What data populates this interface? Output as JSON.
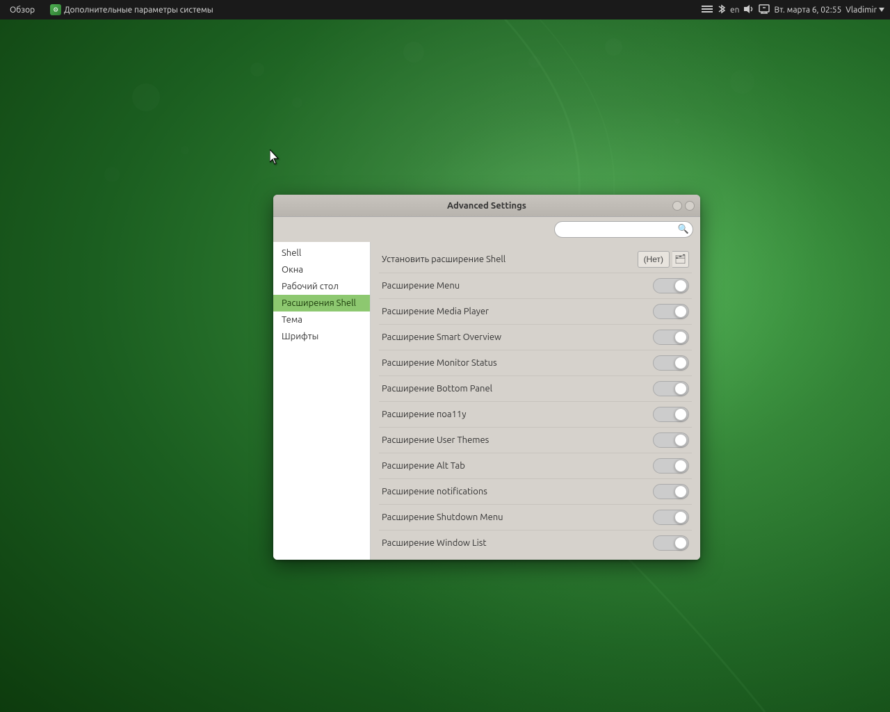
{
  "desktop": {
    "bg_color_start": "#4caf50",
    "bg_color_end": "#0d3b0d"
  },
  "topbar": {
    "overview_label": "Обзор",
    "app_title": "Дополнительные параметры системы",
    "indicators": {
      "network": "⊞",
      "bluetooth": "⬡",
      "lang": "en",
      "volume": "🔊",
      "screen": "⬛",
      "datetime": "Вт. марта  6, 02:55",
      "user": "Vladimir",
      "user_icon": "👤"
    }
  },
  "dialog": {
    "title": "Advanced Settings",
    "win_btn_min": "○",
    "win_btn_close": "○",
    "search_placeholder": "",
    "sidebar": {
      "items": [
        {
          "id": "shell",
          "label": "Shell",
          "active": false
        },
        {
          "id": "okna",
          "label": "Окна",
          "active": false
        },
        {
          "id": "rabochiy",
          "label": "Рабочий стол",
          "active": false
        },
        {
          "id": "rasshireniya",
          "label": "Расширения Shell",
          "active": true
        },
        {
          "id": "tema",
          "label": "Тема",
          "active": false
        },
        {
          "id": "shrifty",
          "label": "Шрифты",
          "active": false
        }
      ]
    },
    "settings": [
      {
        "id": "install-shell",
        "label": "Установить расширение Shell",
        "control_type": "install",
        "install_label": "(Нет)"
      },
      {
        "id": "menu",
        "label": "Расширение Menu",
        "control_type": "toggle"
      },
      {
        "id": "media-player",
        "label": "Расширение Media Player",
        "control_type": "toggle"
      },
      {
        "id": "smart-overview",
        "label": "Расширение Smart Overview",
        "control_type": "toggle"
      },
      {
        "id": "monitor-status",
        "label": "Расширение Monitor Status",
        "control_type": "toggle"
      },
      {
        "id": "bottom-panel",
        "label": "Расширение Bottom Panel",
        "control_type": "toggle"
      },
      {
        "id": "noa11y",
        "label": "Расширение пoa11y",
        "control_type": "toggle"
      },
      {
        "id": "user-themes",
        "label": "Расширение User Themes",
        "control_type": "toggle"
      },
      {
        "id": "alt-tab",
        "label": "Расширение Alt Tab",
        "control_type": "toggle"
      },
      {
        "id": "notifications",
        "label": "Расширение notifications",
        "control_type": "toggle"
      },
      {
        "id": "shutdown-menu",
        "label": "Расширение Shutdown Menu",
        "control_type": "toggle"
      },
      {
        "id": "window-list",
        "label": "Расширение Window List",
        "control_type": "toggle"
      }
    ]
  }
}
